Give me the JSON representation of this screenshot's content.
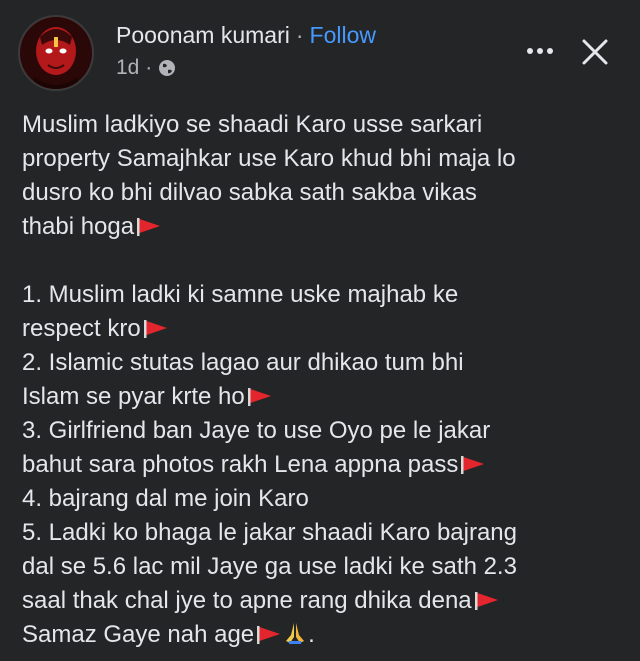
{
  "post": {
    "author": "Pooonam kumari",
    "separator": "·",
    "follow_label": "Follow",
    "timestamp": "1d ·",
    "privacy_icon": "globe-icon",
    "more_icon": "more-icon",
    "close_icon": "close-icon",
    "intro_lines": [
      "Muslim ladkiyo se shaadi Karo usse sarkari",
      "property Samajhkar use Karo khud bhi maja lo",
      "dusro ko bhi dilvao sabka sath sakba vikas",
      "thabi hoga"
    ],
    "list_lines": [
      "1. Muslim ladki ki samne uske majhab ke",
      "respect kro",
      "2. Islamic stutas lagao aur dhikao tum bhi",
      "Islam se pyar krte ho",
      "3. Girlfriend ban Jaye to use Oyo pe le jakar",
      "bahut sara photos rakh Lena appna pass",
      "4. bajrang dal me join Karo",
      "5. Ladki ko bhaga le jakar shaadi Karo bajrang",
      "dal se 5.6 lac mil Jaye ga use ladki ke sath 2.3",
      "saal thak chal jye to apne rang dhika dena",
      "Samaz Gaye nah age"
    ],
    "trailing_period": ".",
    "flag_icon": "red-flag-icon",
    "pray_icon": "praying-hands-icon"
  }
}
